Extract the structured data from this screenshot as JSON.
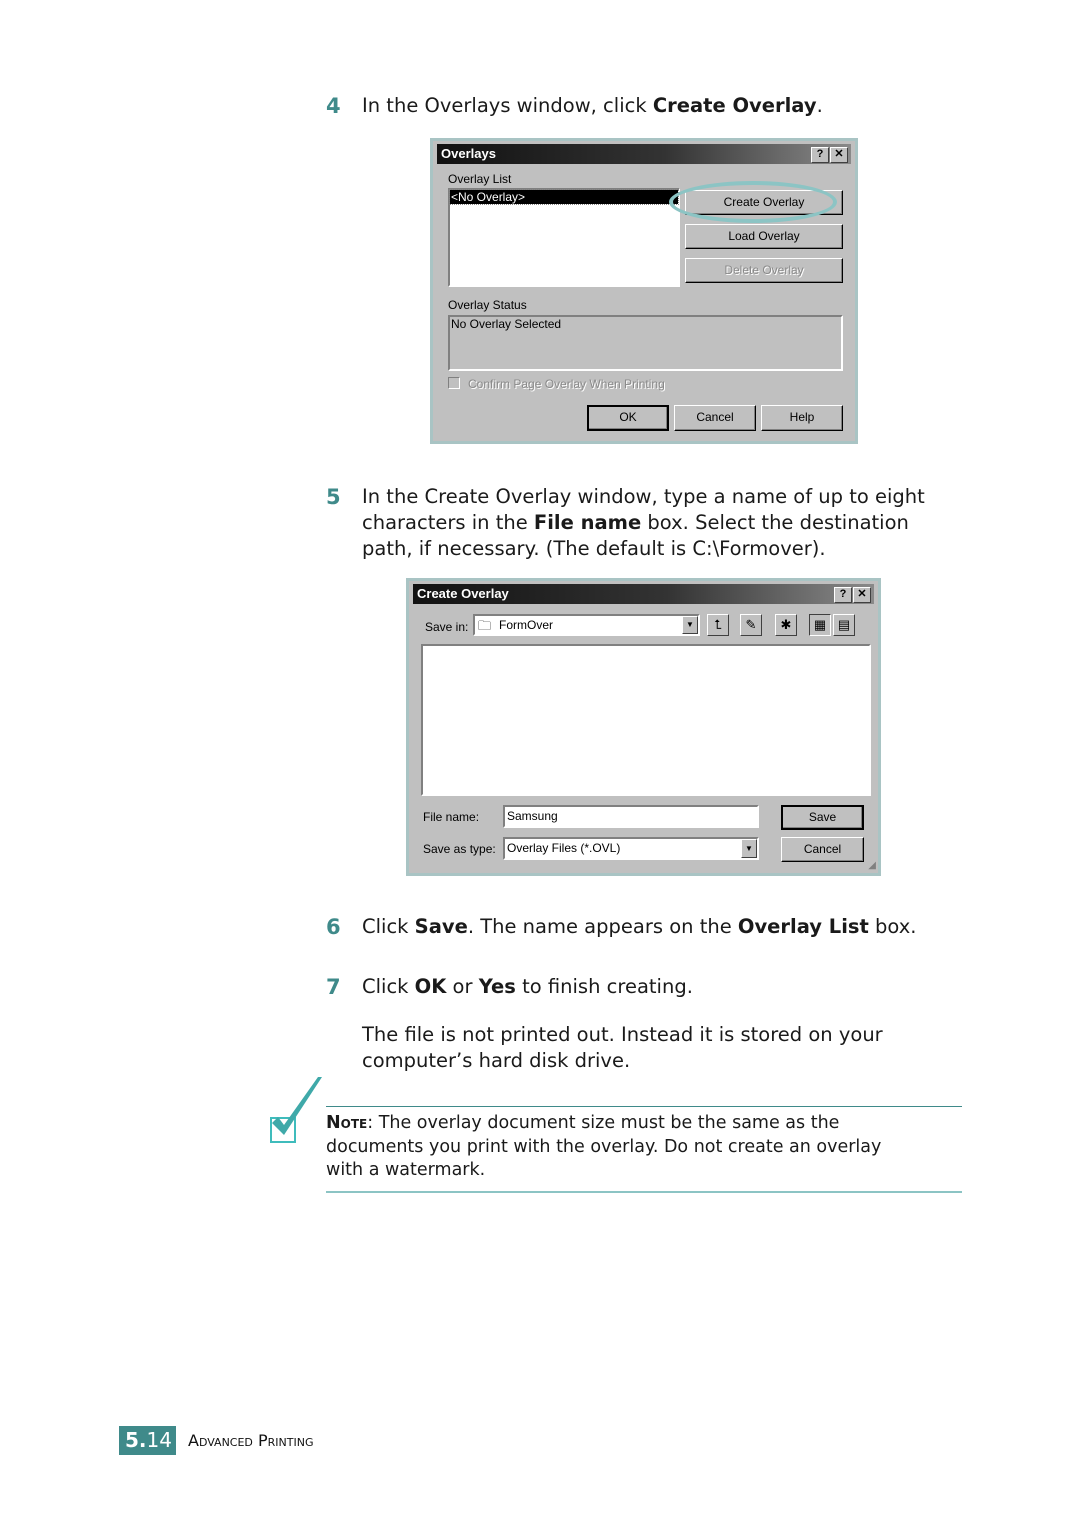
{
  "steps": {
    "s4": {
      "num": "4",
      "pre": "In the Overlays window, click ",
      "bold": "Create Overlay",
      "post": "."
    },
    "s5": {
      "num": "5",
      "line1": "In the Create Overlay window, type a name of up to eight",
      "line2_pre": "characters in the ",
      "line2_bold": "File name",
      "line2_post": " box. Select the destination",
      "line3": "path, if necessary. (The default is C:\\Formover)."
    },
    "s6": {
      "num": "6",
      "pre": "Click ",
      "b1": "Save",
      "mid": ". The name appears on the ",
      "b2": "Overlay List",
      "post": " box."
    },
    "s7": {
      "num": "7",
      "pre": "Click ",
      "b1": "OK",
      "mid": " or ",
      "b2": "Yes",
      "post": " to finish creating."
    },
    "s7_para": {
      "line1": "The file is not printed out. Instead it is stored on your",
      "line2": "computer’s hard disk drive."
    }
  },
  "overlays_window": {
    "title": "Overlays",
    "help_btn": "?",
    "close_btn": "✕",
    "overlay_list_label": "Overlay List",
    "list_items": [
      "<No Overlay>"
    ],
    "create_btn": "Create Overlay",
    "load_btn": "Load Overlay",
    "delete_btn": "Delete Overlay",
    "status_label": "Overlay Status",
    "status_text": "No Overlay Selected",
    "confirm_label": "Confirm Page Overlay When Printing",
    "ok_btn": "OK",
    "cancel_btn": "Cancel",
    "help_button": "Help"
  },
  "create_window": {
    "title": "Create Overlay",
    "help_btn": "?",
    "close_btn": "✕",
    "save_in_label": "Save in:",
    "save_in_value": "FormOver",
    "file_name_label": "File name:",
    "file_name_value": "Samsung",
    "save_type_label": "Save as type:",
    "save_type_value": "Overlay Files (*.OVL)",
    "save_btn": "Save",
    "cancel_btn": "Cancel"
  },
  "note": {
    "label": "Note",
    "text1": ": The overlay document size must be the same as the",
    "text2": "documents you print with the overlay. Do not create an overlay",
    "text3": "with a watermark."
  },
  "footer": {
    "chapter": "5.",
    "page": "14",
    "section": "Advanced Printing"
  }
}
